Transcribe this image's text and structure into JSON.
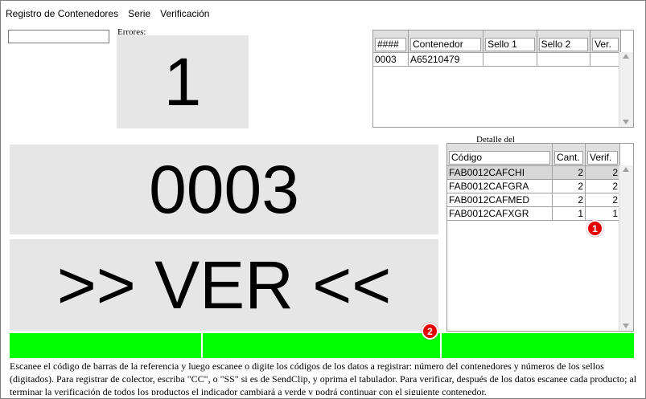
{
  "menu": [
    "Registro de Contenedores",
    "Serie",
    "Verificación"
  ],
  "input": {
    "value": ""
  },
  "errors": {
    "label": "Errores:",
    "value": "1"
  },
  "current_number": "0003",
  "status_text": ">> VER <<",
  "containers_table": {
    "headers": [
      "####",
      "Contenedor",
      "Sello 1",
      "Sello 2",
      "Ver."
    ],
    "rows": [
      [
        "0003",
        "A65210479",
        "",
        "",
        ""
      ]
    ]
  },
  "detail_label": "Detalle del",
  "detail_table": {
    "headers": [
      "Código",
      "Cant.",
      "Verif."
    ],
    "rows": [
      [
        "FAB0012CAFCHI",
        "2",
        "2"
      ],
      [
        "FAB0012CAFGRA",
        "2",
        "2"
      ],
      [
        "FAB0012CAFMED",
        "2",
        "2"
      ],
      [
        "FAB0012CAFXGR",
        "1",
        "1"
      ]
    ]
  },
  "badges": [
    "1",
    "2"
  ],
  "colors": {
    "panel": "#e6e6e6",
    "progress": "#00ff00",
    "badge": "#e60000"
  },
  "help_text": "Escanee el código de barras de la referencia y luego escanee o digite los códigos de los datos a registrar: número del contenedores y números de los sellos (digitados). Para registrar de colector, escriba \"CC\", o \"SS\" si es de SendClip, y oprima el tabulador. Para verificar, después de los datos escanee cada producto; al terminar la verificación de todos los productos el indicador cambiará a verde y podrá continuar con el siguiente contenedor."
}
